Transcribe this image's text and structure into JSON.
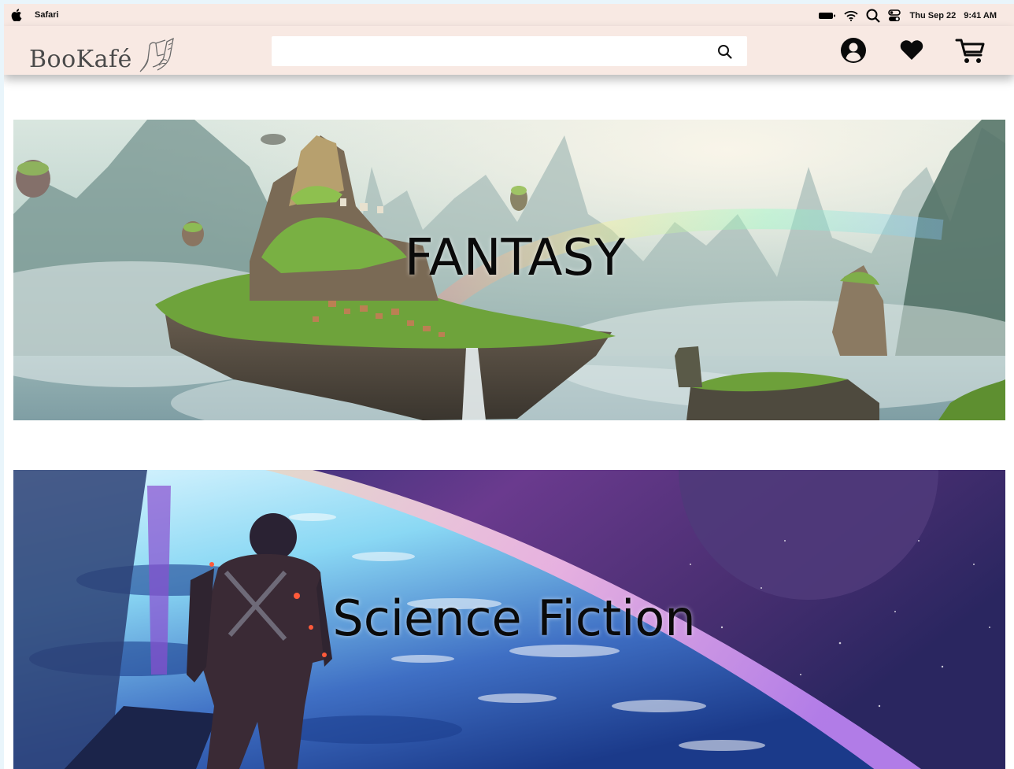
{
  "menubar": {
    "app_name": "Safari",
    "date": "Thu Sep 22",
    "time": "9:41 AM"
  },
  "header": {
    "logo_text": "BooKafé",
    "search": {
      "value": "",
      "placeholder": ""
    }
  },
  "banners": [
    {
      "title": "FANTASY"
    },
    {
      "title": "Science Fiction"
    }
  ],
  "colors": {
    "header_bg": "#f8e9e3",
    "page_bg": "#ffffff",
    "outer_bg": "#e9f5fb",
    "text": "#0a0a0a"
  },
  "icons": [
    "apple-icon",
    "battery-icon",
    "wifi-icon",
    "spotlight-icon",
    "control-center-icon",
    "book-hand-logo-icon",
    "search-icon",
    "account-icon",
    "heart-icon",
    "cart-icon"
  ]
}
